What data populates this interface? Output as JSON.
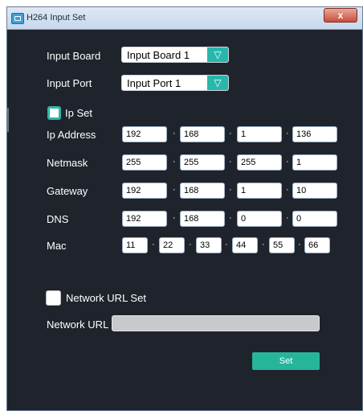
{
  "window": {
    "title": "H264 Input Set",
    "close_symbol": "x"
  },
  "input_board": {
    "label": "Input Board",
    "value": "Input Board 1"
  },
  "input_port": {
    "label": "Input Port",
    "value": "Input Port 1"
  },
  "ip_set": {
    "label": "Ip Set",
    "checked": true
  },
  "ip_address": {
    "label": "Ip Address",
    "octets": [
      "192",
      "168",
      "1",
      "136"
    ]
  },
  "netmask": {
    "label": "Netmask",
    "octets": [
      "255",
      "255",
      "255",
      "1"
    ]
  },
  "gateway": {
    "label": "Gateway",
    "octets": [
      "192",
      "168",
      "1",
      "10"
    ]
  },
  "dns": {
    "label": "DNS",
    "octets": [
      "192",
      "168",
      "0",
      "0"
    ]
  },
  "mac": {
    "label": "Mac",
    "octets": [
      "11",
      "22",
      "33",
      "44",
      "55",
      "66"
    ]
  },
  "separator": "·",
  "dropdown_arrow": "▽",
  "network_url_set": {
    "label": "Network URL Set",
    "checked": false
  },
  "network_url": {
    "label": "Network URL",
    "value": ""
  },
  "set_button": {
    "label": "Set"
  },
  "colors": {
    "accent": "#27b7ad",
    "background": "#1f232c"
  }
}
